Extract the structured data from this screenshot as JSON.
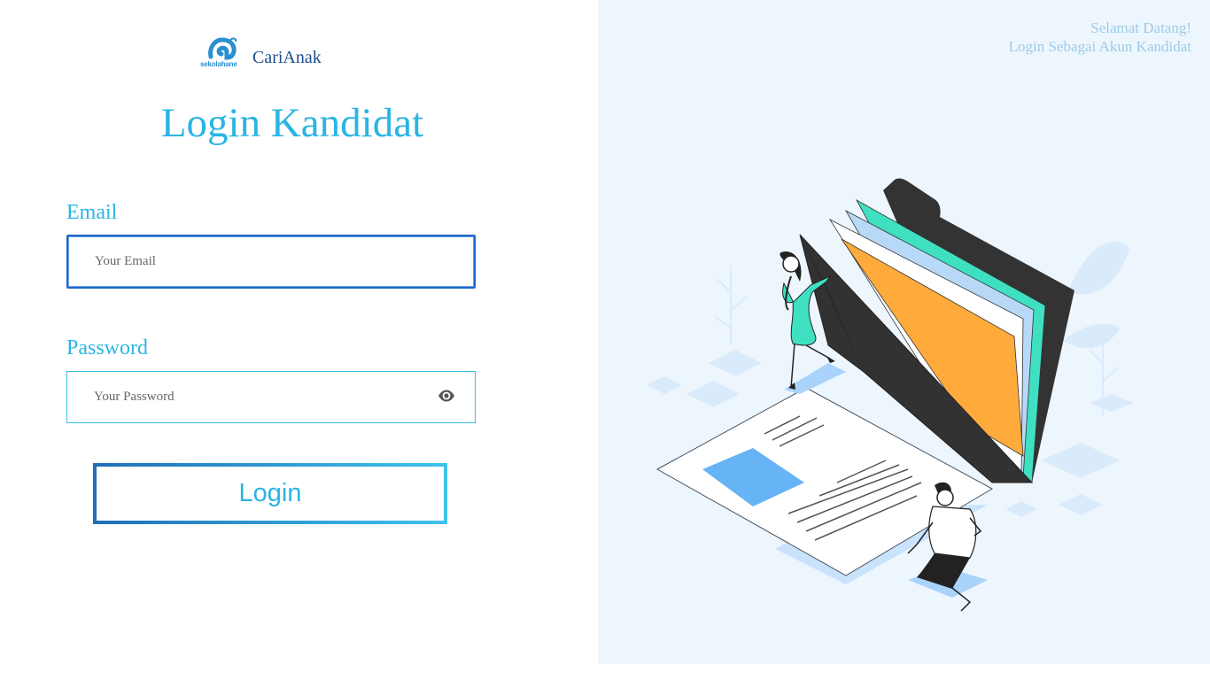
{
  "brand": {
    "logo_text": "sekolahane",
    "name": "CariAnak"
  },
  "title": "Login Kandidat",
  "form": {
    "email_label": "Email",
    "email_placeholder": "Your Email",
    "password_label": "Password",
    "password_placeholder": "Your Password",
    "toggle_icon": "eye-icon",
    "login_label": "Login"
  },
  "greeting": {
    "line1": "Selamat Datang!",
    "line2": "Login Sebagai Akun Kandidat"
  },
  "colors": {
    "accent": "#2ab5e4",
    "brand_dark": "#1e4d8c",
    "panel_bg": "#eef6fd",
    "email_focus_border": "#1c66c9"
  }
}
